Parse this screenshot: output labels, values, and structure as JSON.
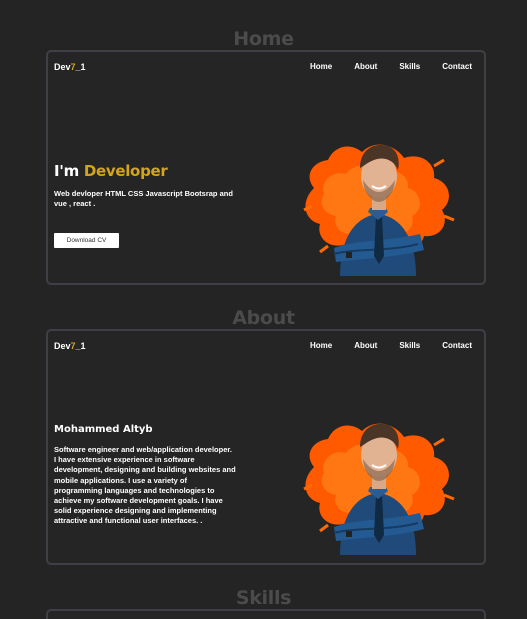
{
  "sections": {
    "home_heading": "Home",
    "about_heading": "About",
    "skills_heading": "Skills"
  },
  "logo": {
    "prefix": "Dev",
    "accent": "7",
    "suffix": "_1"
  },
  "nav": {
    "home": "Home",
    "about": "About",
    "skills": "Skills",
    "contact": "Contact"
  },
  "hero": {
    "title_prefix": "I'm",
    "title_accent": "Developer",
    "description": "Web devloper HTML CSS Javascript Bootsrap and vue , react .",
    "button_label": "Download CV",
    "portrait_icon": "developer-portrait-image"
  },
  "about": {
    "name": "Mohammed Altyb",
    "description": "Software engineer and web/application developer. I have extensive experience in software development, designing and building websites and mobile applications. I use a variety of programming languages and technologies to achieve my software development goals. I have solid experience designing and implementing attractive and functional user interfaces. ."
  },
  "colors": {
    "background": "#242424",
    "accent": "#d4a51c",
    "card_border": "#3f4046",
    "heading_gray": "#4b4b4b",
    "splash_orange": "#ff5a00",
    "shirt_blue": "#1f4a7a"
  }
}
